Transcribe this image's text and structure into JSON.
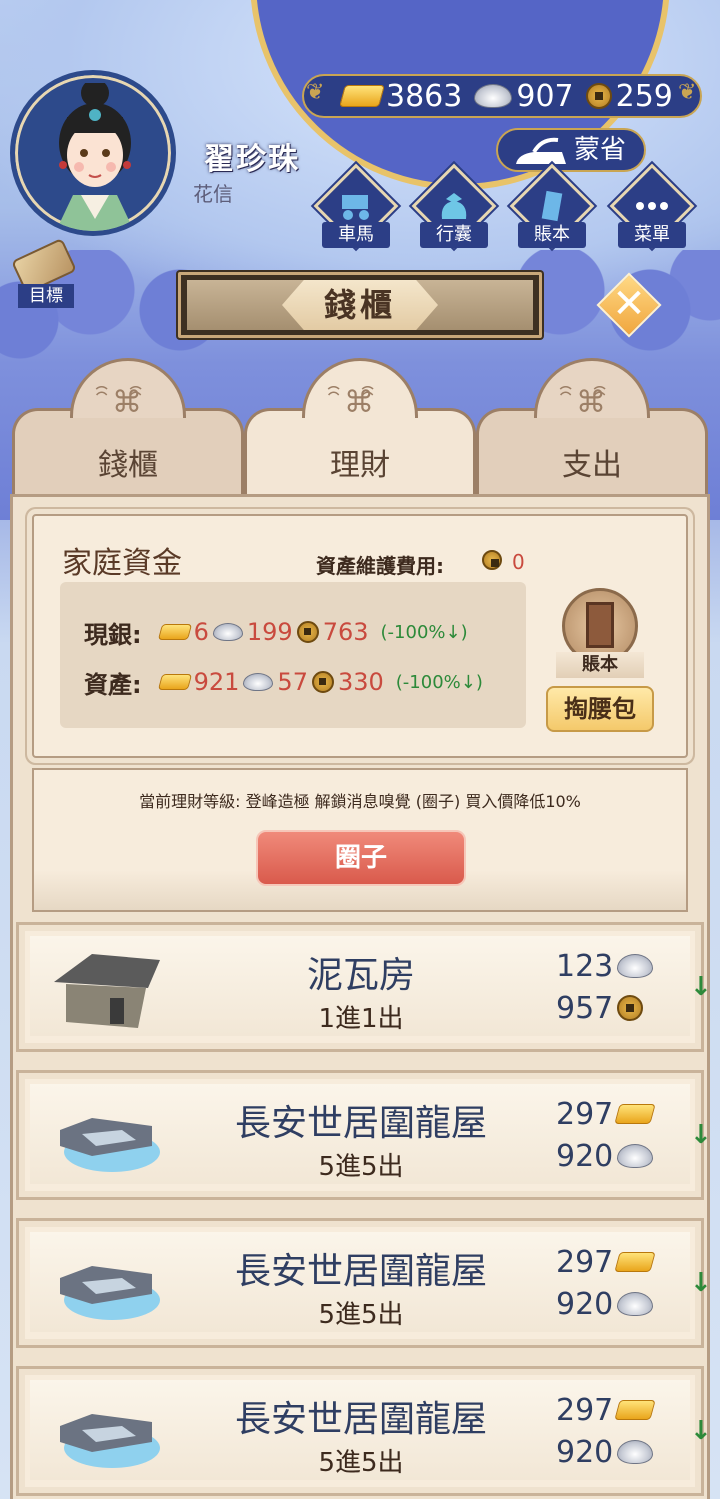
{
  "player": {
    "name": "翟珍珠",
    "subtitle": "花信"
  },
  "currency": {
    "gold": "3863",
    "silver": "907",
    "copper": "259"
  },
  "menglabel": "蒙省",
  "menu": [
    {
      "label": "車馬",
      "icon": "carriage-icon"
    },
    {
      "label": "行囊",
      "icon": "bundle-icon"
    },
    {
      "label": "賬本",
      "icon": "ledger-icon"
    },
    {
      "label": "菜單",
      "icon": "more-icon"
    }
  ],
  "target_label": "目標",
  "title": "錢櫃",
  "tabs": [
    {
      "label": "錢櫃",
      "active": false
    },
    {
      "label": "理財",
      "active": true
    },
    {
      "label": "支出",
      "active": false
    }
  ],
  "fund": {
    "title": "家庭資金",
    "maint_label": "資產維護費用:",
    "maint_value": "0",
    "cash_label": "現銀:",
    "cash_gold": "6",
    "cash_silver": "199",
    "cash_copper": "763",
    "cash_change": "(-100%↓)",
    "asset_label": "資產:",
    "asset_gold": "921",
    "asset_silver": "57",
    "asset_copper": "330",
    "asset_change": "(-100%↓)",
    "ledger_label": "賬本",
    "wallet_label": "掏腰包"
  },
  "level": {
    "text": "當前理財等級: 登峰造極 解鎖消息嗅覺 (圈子) 買入價降低10%",
    "circle_button": "圈子"
  },
  "properties": [
    {
      "name": "泥瓦房",
      "desc": "1進1出",
      "price1": "123",
      "cur1": "silver",
      "price2": "957",
      "cur2": "copper",
      "trend": "↓"
    },
    {
      "name": "長安世居圍龍屋",
      "desc": "5進5出",
      "price1": "297",
      "cur1": "gold",
      "price2": "920",
      "cur2": "silver",
      "trend": "↓"
    },
    {
      "name": "長安世居圍龍屋",
      "desc": "5進5出",
      "price1": "297",
      "cur1": "gold",
      "price2": "920",
      "cur2": "silver",
      "trend": "↓"
    },
    {
      "name": "長安世居圍龍屋",
      "desc": "5進5出",
      "price1": "297",
      "cur1": "gold",
      "price2": "920",
      "cur2": "silver",
      "trend": "↓"
    }
  ]
}
